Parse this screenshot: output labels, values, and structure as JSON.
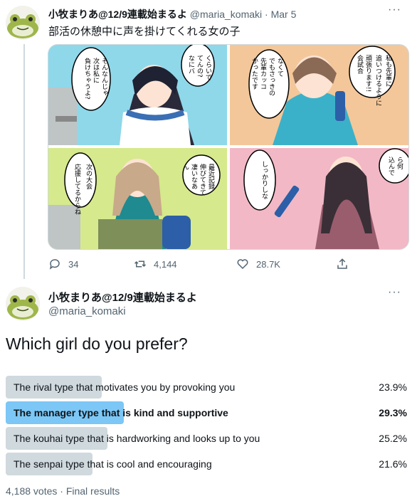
{
  "tweet1": {
    "display_name": "小牧まりあ@12/9連載始まるよ",
    "handle": "@maria_komaki",
    "separator": "·",
    "date": "Mar 5",
    "text": "部活の休憩中に声を掛けてくれる女の子",
    "replies": "34",
    "retweets": "4,144",
    "likes": "28.7K",
    "avatar_icon": "frog-avatar-icon"
  },
  "media": {
    "panel1": {
      "bubbles": [
        "そんなんじゃ",
        "次は私に",
        "負けちゃうよ?",
        "くらいで",
        "てんの?",
        "なにバ"
      ]
    },
    "panel2": {
      "bubbles": [
        "なくて",
        "でもさっきの",
        "先輩カッコ",
        "かったです",
        "私も先輩に",
        "追いつけるように",
        "頑張ります!!",
        "会試合"
      ]
    },
    "panel3": {
      "bubbles": [
        "次の大会",
        "応援してるからね",
        "最近記録",
        "伸びてきて",
        "凄いなあ",
        "ん"
      ]
    },
    "panel4": {
      "bubbles": [
        "しっかりしな",
        "ら何",
        "込んで"
      ]
    }
  },
  "tweet2": {
    "display_name": "小牧まりあ@12/9連載始まるよ",
    "handle": "@maria_komaki",
    "question": "Which girl do you prefer?"
  },
  "poll": {
    "options": [
      {
        "label": "The rival type that motivates you by provoking you",
        "pct": "23.9%",
        "value": 23.9
      },
      {
        "label": "The manager type that is kind and supportive",
        "pct": "29.3%",
        "value": 29.3
      },
      {
        "label": "The kouhai type that is hardworking and looks up to you",
        "pct": "25.2%",
        "value": 25.2
      },
      {
        "label": "The senpai type that is cool and encouraging",
        "pct": "21.6%",
        "value": 21.6
      }
    ],
    "winner_index": 1,
    "summary": "4,188 votes · Final results"
  },
  "colors": {
    "accent": "#1d9bf0",
    "winner_bar": "#7cc7f5",
    "loser_bar": "#cfd9de",
    "muted_text": "#536471"
  }
}
